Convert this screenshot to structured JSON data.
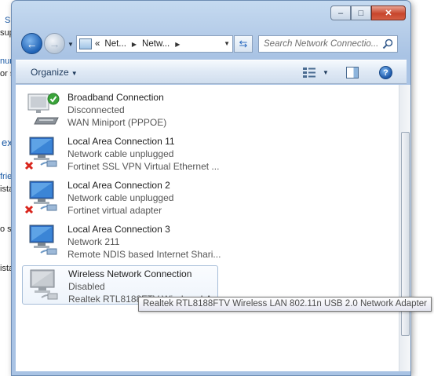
{
  "background_window": {
    "fragments": [
      "Su",
      "sup",
      "nun",
      "or s",
      "ex",
      "frie",
      "ista",
      "o sy",
      "ista"
    ]
  },
  "window": {
    "caption": {
      "minimize": "–",
      "maximize": "□",
      "close": "✕"
    },
    "nav": {
      "back_glyph": "←",
      "forward_glyph": "→",
      "address_prefix": "«",
      "address_crumbs": [
        "Net...",
        "Netw..."
      ],
      "search_placeholder": "Search Network Connectio..."
    },
    "command_bar": {
      "organize_label": "Organize",
      "help_glyph": "?"
    },
    "connections": [
      {
        "name": "Broadband Connection",
        "status": "Disconnected",
        "device": "WAN Miniport (PPPOE)",
        "icon": "broadband-icon",
        "overlay": "check-icon"
      },
      {
        "name": "Local Area Connection 11",
        "status": "Network cable unplugged",
        "device": "Fortinet SSL VPN Virtual Ethernet ...",
        "icon": "network-adapter-icon",
        "overlay": "red-x-icon"
      },
      {
        "name": "Local Area Connection 2",
        "status": "Network cable unplugged",
        "device": "Fortinet virtual adapter",
        "icon": "network-adapter-icon",
        "overlay": "red-x-icon"
      },
      {
        "name": "Local Area Connection 3",
        "status": "Network  211",
        "device": "Remote NDIS based Internet Shari...",
        "icon": "network-adapter-icon",
        "overlay": ""
      },
      {
        "name": "Wireless Network Connection",
        "status": "Disabled",
        "device": "Realtek RTL8188FTV Wireless LAN ...",
        "icon": "wireless-adapter-icon",
        "overlay": ""
      }
    ],
    "tooltip": "Realtek RTL8188FTV Wireless LAN 802.11n USB 2.0 Network Adapter"
  },
  "colors": {
    "accent": "#1f62b5",
    "frame": "#a9c3e4",
    "error": "#d9251c",
    "ok": "#3aa43a"
  }
}
